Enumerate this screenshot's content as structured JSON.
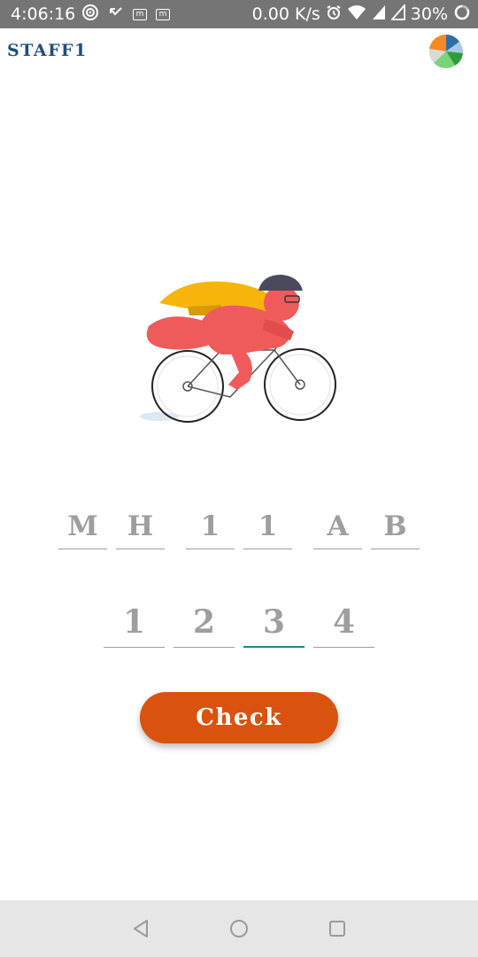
{
  "status_bar": {
    "time": "4:06:16",
    "network_speed": "0.00 K/s",
    "battery": "30%",
    "notification_icons": [
      "music-icon",
      "missed-call-icon",
      "m-icon",
      "m-icon"
    ],
    "system_icons": [
      "alarm-icon",
      "wifi-icon",
      "signal-icon",
      "signal-icon",
      "battery-icon"
    ]
  },
  "app_bar": {
    "title": "STAFF1",
    "logo_icon": "pie-chart-logo-icon"
  },
  "illustration": {
    "icon": "cyclist-illustration",
    "colors": {
      "body": "#ef5b5b",
      "cape": "#f7b50a",
      "helmet": "#4a4a5e"
    }
  },
  "plate_inputs": {
    "chars": [
      "M",
      "H",
      "1",
      "1",
      "A",
      "B"
    ]
  },
  "pin_inputs": {
    "digits": [
      "1",
      "2",
      "3",
      "4"
    ],
    "active_index": 2
  },
  "check_button": {
    "label": "Check",
    "color": "#d9530e"
  },
  "colors": {
    "title": "#1f4e79",
    "input_text": "#9e9e9e",
    "active_underline": "#138a85",
    "status_bar": "#757575",
    "nav_bar": "#e6e6e6"
  },
  "nav_bar": {
    "icons": [
      "back-icon",
      "home-icon",
      "recents-icon"
    ]
  }
}
